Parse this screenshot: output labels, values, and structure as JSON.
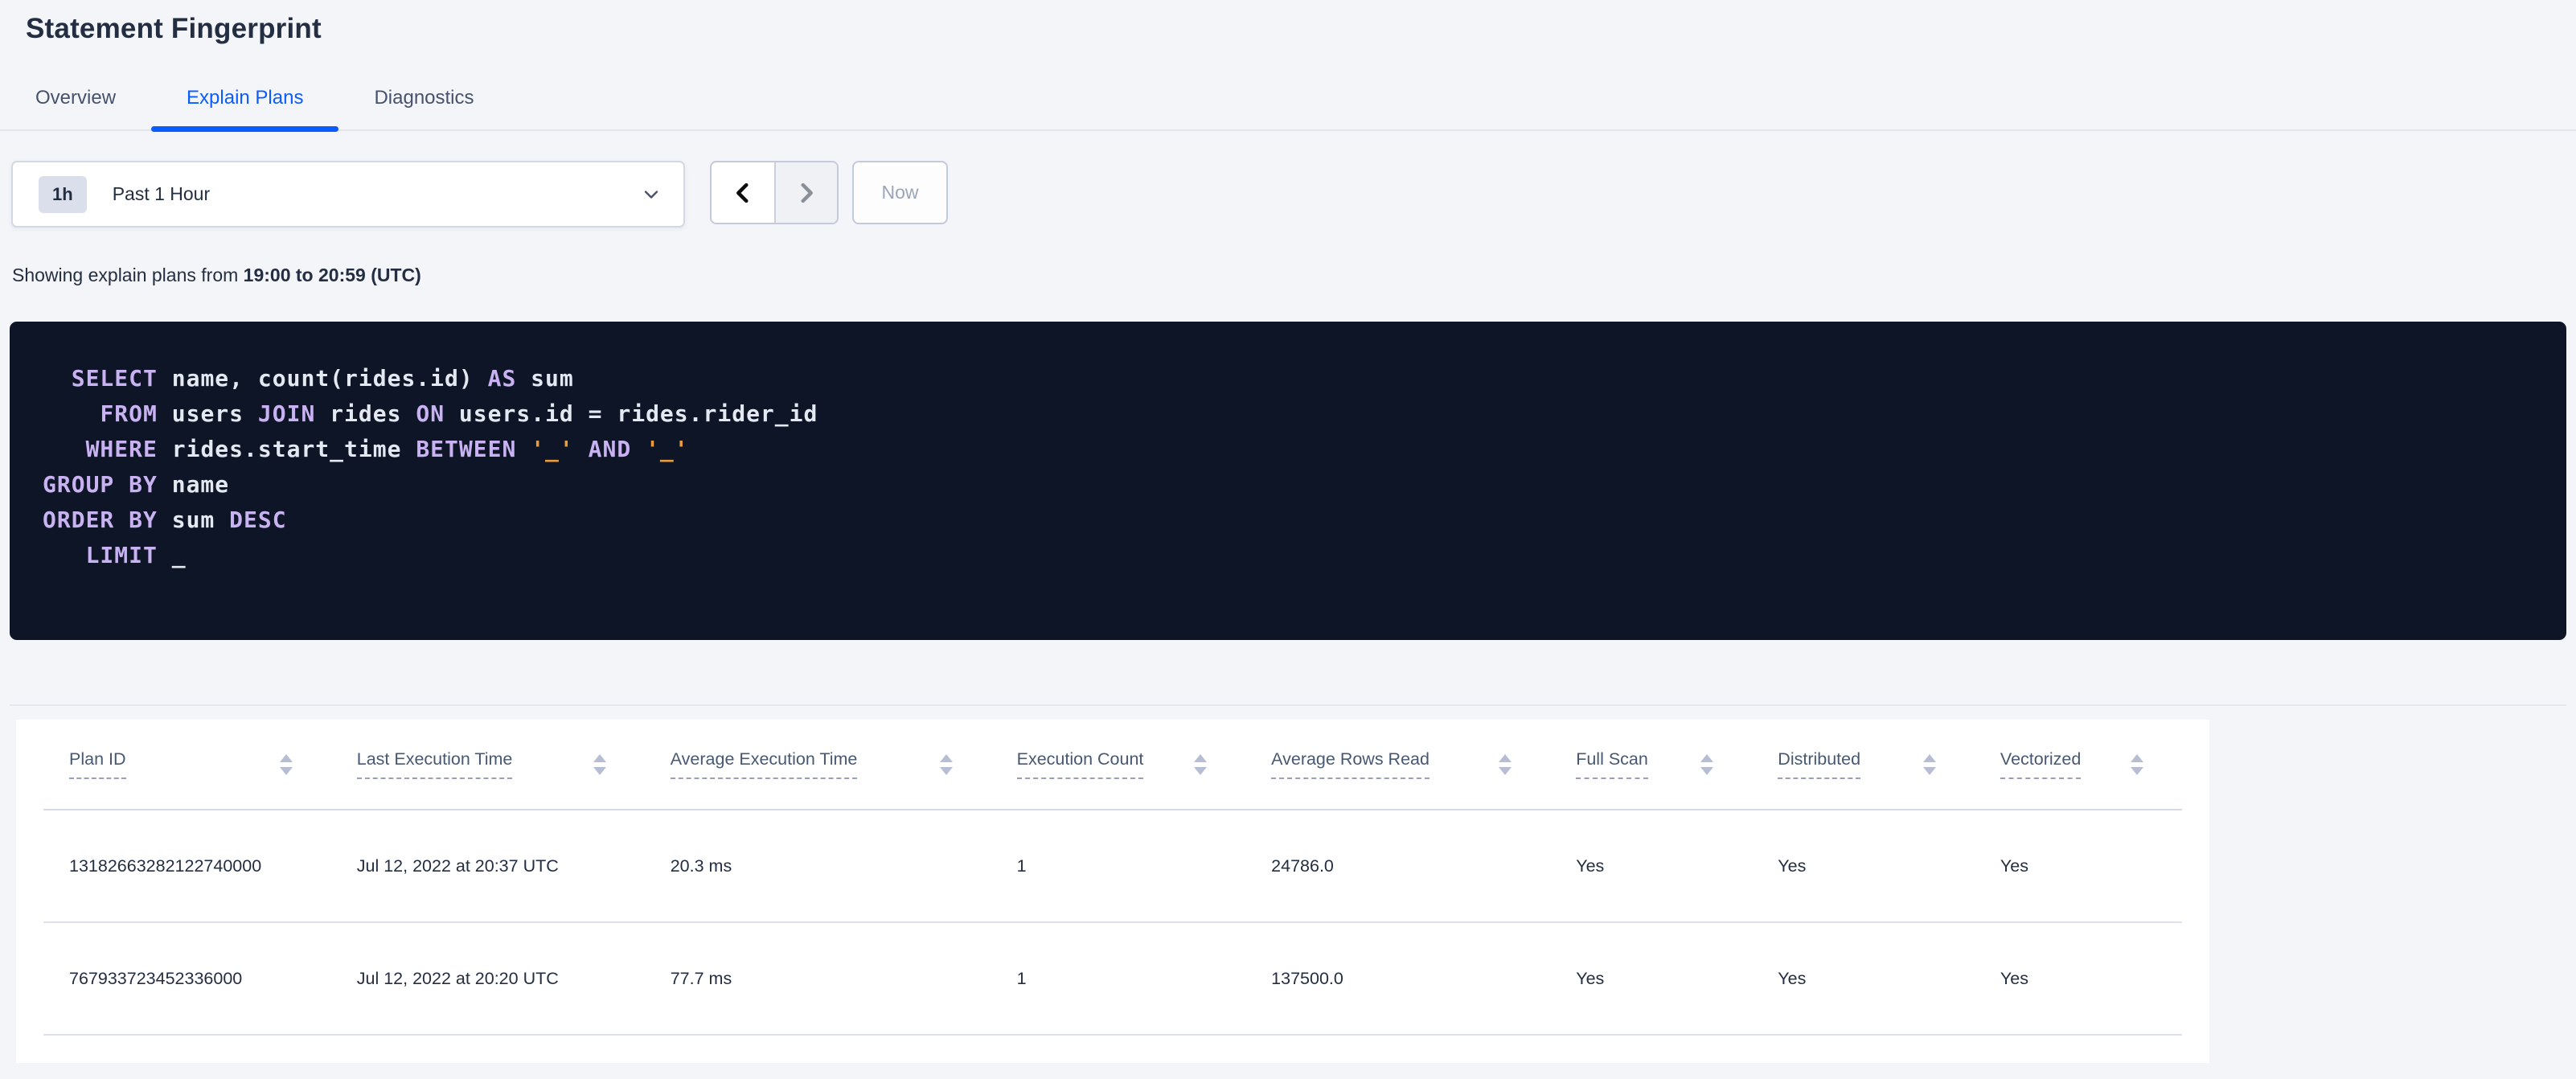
{
  "colors": {
    "accent_blue": "#0b5cff",
    "page_bg": "#f4f5f9",
    "title_text": "#242e42",
    "tab_inactive_text": "#46526b",
    "sql_bg": "#0d1526",
    "sql_keyword": "#c8b2f2",
    "sql_plain": "#e4e8f1",
    "sql_string": "#e89c3f",
    "table_header_text": "#475872",
    "table_cell_text": "#242e42",
    "disabled_button_text": "#9aa5ba"
  },
  "header": {
    "title": "Statement Fingerprint"
  },
  "tabs": [
    {
      "label": "Overview",
      "active": false
    },
    {
      "label": "Explain Plans",
      "active": true
    },
    {
      "label": "Diagnostics",
      "active": false
    }
  ],
  "time_picker": {
    "badge": "1h",
    "selected": "Past 1 Hour",
    "now_label": "Now"
  },
  "caption": {
    "prefix": "Showing explain plans from ",
    "range_bold": "19:00 to 20:59 (UTC)"
  },
  "sql": {
    "lines": [
      [
        {
          "t": "  "
        },
        {
          "t": "SELECT",
          "c": "kw"
        },
        {
          "t": " name, count(rides.id) "
        },
        {
          "t": "AS",
          "c": "kw"
        },
        {
          "t": " sum"
        }
      ],
      [
        {
          "t": "    "
        },
        {
          "t": "FROM",
          "c": "kw"
        },
        {
          "t": " users "
        },
        {
          "t": "JOIN",
          "c": "kw"
        },
        {
          "t": " rides "
        },
        {
          "t": "ON",
          "c": "kw"
        },
        {
          "t": " users.id = rides.rider_id"
        }
      ],
      [
        {
          "t": "   "
        },
        {
          "t": "WHERE",
          "c": "kw"
        },
        {
          "t": " rides.start_time "
        },
        {
          "t": "BETWEEN",
          "c": "kw"
        },
        {
          "t": " "
        },
        {
          "t": "'_'",
          "c": "str"
        },
        {
          "t": " "
        },
        {
          "t": "AND",
          "c": "kw"
        },
        {
          "t": " "
        },
        {
          "t": "'_'",
          "c": "str"
        }
      ],
      [
        {
          "t": "GROUP BY",
          "c": "kw"
        },
        {
          "t": " name"
        }
      ],
      [
        {
          "t": "ORDER BY",
          "c": "kw"
        },
        {
          "t": " sum "
        },
        {
          "t": "DESC",
          "c": "kw"
        }
      ],
      [
        {
          "t": "   "
        },
        {
          "t": "LIMIT",
          "c": "kw"
        },
        {
          "t": " _"
        }
      ]
    ]
  },
  "table": {
    "columns": [
      "Plan ID",
      "Last Execution Time",
      "Average Execution Time",
      "Execution Count",
      "Average Rows Read",
      "Full Scan",
      "Distributed",
      "Vectorized"
    ],
    "rows": [
      [
        "13182663282122740000",
        "Jul 12, 2022 at 20:37 UTC",
        "20.3 ms",
        "1",
        "24786.0",
        "Yes",
        "Yes",
        "Yes"
      ],
      [
        "767933723452336000",
        "Jul 12, 2022 at 20:20 UTC",
        "77.7 ms",
        "1",
        "137500.0",
        "Yes",
        "Yes",
        "Yes"
      ]
    ]
  }
}
